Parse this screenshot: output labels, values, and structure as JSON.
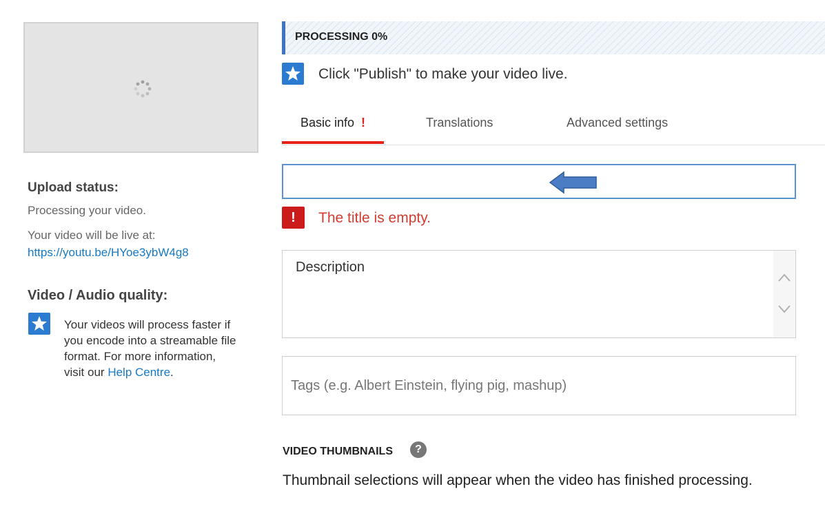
{
  "left_panel": {
    "upload_status_heading": "Upload status:",
    "processing_text": "Processing your video.",
    "live_at_label": "Your video will be live at:",
    "video_url": "https://youtu.be/HYoe3ybW4g8",
    "quality_heading": "Video / Audio quality:",
    "tip_text": "Your videos will process faster if you encode into a streamable file format. For more information, visit our",
    "help_link": "Help Centre",
    "help_suffix": "."
  },
  "processing": {
    "label": "PROCESSING 0%",
    "progress_percent": 0
  },
  "publish_notice": "Click \"Publish\" to make your video live.",
  "tabs": [
    {
      "label": "Basic info",
      "alert": "!",
      "active": true
    },
    {
      "label": "Translations",
      "active": false
    },
    {
      "label": "Advanced settings",
      "active": false
    }
  ],
  "title_field": {
    "value": "",
    "placeholder": ""
  },
  "error": {
    "icon": "!",
    "message": "The title is empty."
  },
  "description_field": {
    "placeholder": "Description"
  },
  "tags_field": {
    "placeholder": "Tags (e.g. Albert Einstein, flying pig, mashup)"
  },
  "thumbnails": {
    "heading": "VIDEO THUMBNAILS",
    "help_icon": "?",
    "message": "Thumbnail selections will appear when the video has finished processing."
  },
  "icons": {
    "spinner": "loading-spinner-icon",
    "star": "star-icon",
    "error": "error-icon",
    "help": "question-icon",
    "arrow": "arrow-left-icon"
  },
  "colors": {
    "accent_blue": "#3d74c9",
    "link": "#167ac6",
    "error_red": "#e62117",
    "input_focus": "#5b93d2"
  }
}
